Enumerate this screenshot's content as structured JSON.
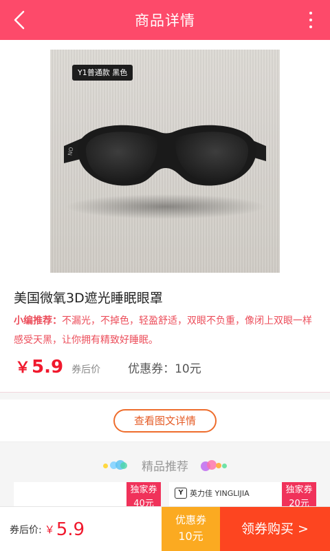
{
  "header": {
    "title": "商品详情",
    "back_icon": "chevron-left-icon",
    "more_icon": "more-vertical-icon"
  },
  "product": {
    "image_tag": "Y1普通款 黑色",
    "name": "美国微氧3D遮光睡眠眼罩",
    "recommend_label": "小编推荐：",
    "recommend_text": "不漏光，不掉色，轻盈舒适，双眼不负重，像闭上双眼一样感受天黑，让你拥有精致好睡眠。",
    "price_symbol": "￥",
    "price": "5.9",
    "price_note": "券后价",
    "coupon_text": "优惠券：10元"
  },
  "detail_button": "查看图文详情",
  "recommend_section": {
    "title": "精品推荐",
    "items": [
      {
        "badge_line1": "独家券",
        "badge_line2": "40元",
        "brand": ""
      },
      {
        "badge_line1": "独家券",
        "badge_line2": "20元",
        "brand": "英力佳 YINGLIJIA"
      }
    ]
  },
  "bottom_bar": {
    "after_label": "券后价:",
    "after_yen": "￥",
    "after_price": "5.9",
    "coupon_line1": "优惠券",
    "coupon_line2": "10元",
    "buy_label": "领券购买 >"
  },
  "colors": {
    "accent": "#fd4a6a",
    "price_red": "#f0192d",
    "coupon_orange": "#fbaa21",
    "buy_red": "#fd4520"
  }
}
